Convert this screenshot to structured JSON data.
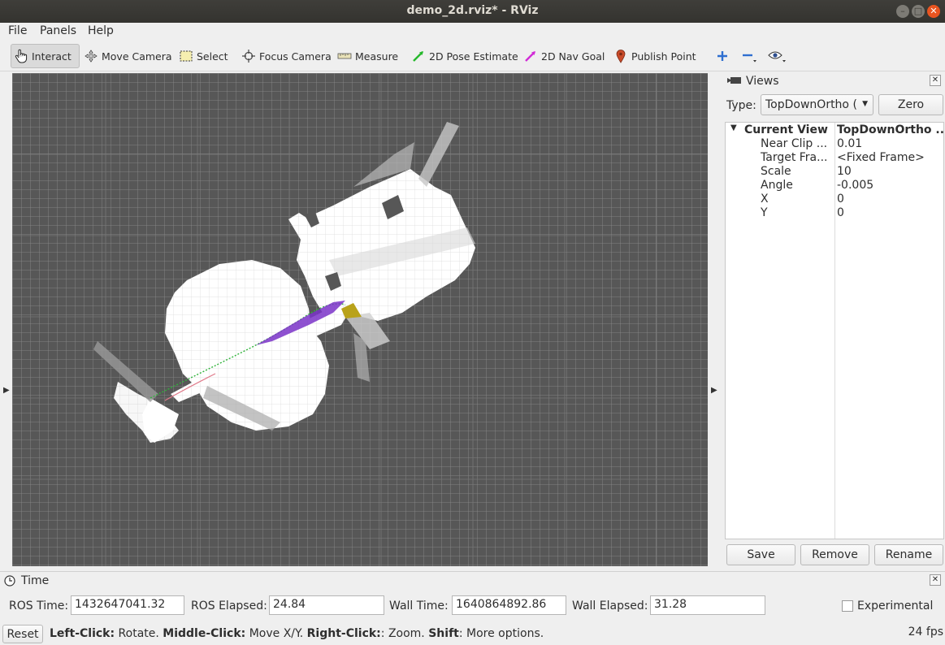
{
  "window": {
    "title": "demo_2d.rviz* - RViz"
  },
  "menu": {
    "file": "File",
    "panels": "Panels",
    "help": "Help"
  },
  "toolbar": {
    "interact": "Interact",
    "move_camera": "Move Camera",
    "select": "Select",
    "focus_camera": "Focus Camera",
    "measure": "Measure",
    "pose_estimate": "2D Pose Estimate",
    "nav_goal": "2D Nav Goal",
    "publish_point": "Publish Point"
  },
  "views_panel": {
    "title": "Views",
    "type_label": "Type:",
    "type_value": "TopDownOrtho (",
    "zero_button": "Zero",
    "current_view_label": "Current View",
    "current_view_value": "TopDownOrtho ...",
    "properties": [
      {
        "key": "Near Clip ...",
        "value": "0.01"
      },
      {
        "key": "Target Fra...",
        "value": "<Fixed Frame>"
      },
      {
        "key": "Scale",
        "value": "10"
      },
      {
        "key": "Angle",
        "value": "-0.005"
      },
      {
        "key": "X",
        "value": "0"
      },
      {
        "key": "Y",
        "value": "0"
      }
    ],
    "save": "Save",
    "remove": "Remove",
    "rename": "Rename"
  },
  "time_panel": {
    "title": "Time",
    "ros_time_label": "ROS Time:",
    "ros_time": "1432647041.32",
    "ros_elapsed_label": "ROS Elapsed:",
    "ros_elapsed": "24.84",
    "wall_time_label": "Wall Time:",
    "wall_time": "1640864892.86",
    "wall_elapsed_label": "Wall Elapsed:",
    "wall_elapsed": "31.28",
    "experimental_label": "Experimental"
  },
  "status": {
    "reset": "Reset",
    "left_click": "Left-Click:",
    "left_click_desc": " Rotate. ",
    "middle_click": "Middle-Click:",
    "middle_click_desc": " Move X/Y. ",
    "right_click": "Right-Click:",
    "right_click_desc": ": Zoom. ",
    "shift": "Shift",
    "shift_desc": ": More options.",
    "fps": "24 fps"
  },
  "colors": {
    "viewport_bg": "#575757",
    "grid": "#a0a0a0",
    "map_free": "#ffffff",
    "path_purple": "#7a33c8",
    "path_green": "#2fb33a",
    "accent_close": "#e95420"
  }
}
